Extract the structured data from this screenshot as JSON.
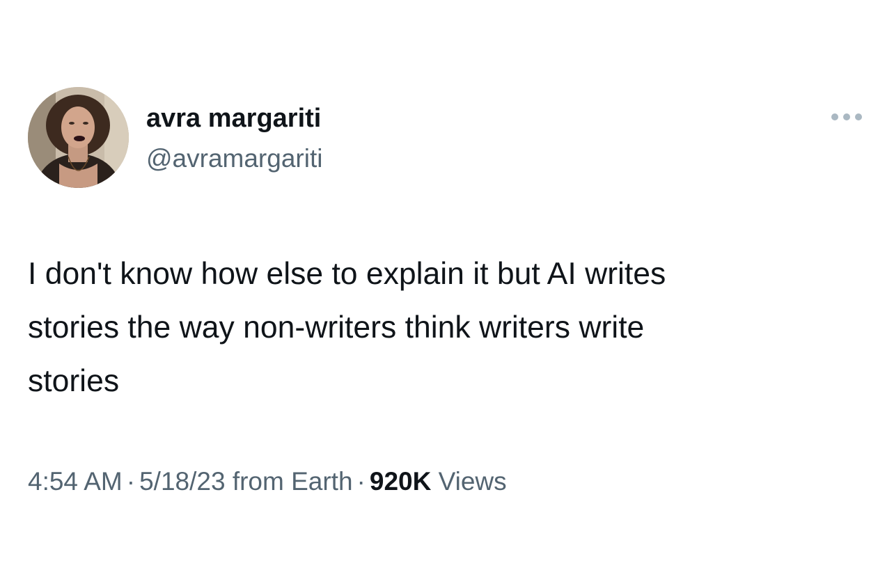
{
  "tweet": {
    "author": {
      "display_name": "avra margariti",
      "handle": "@avramargariti",
      "avatar_icon": "profile-photo"
    },
    "more_icon": "more-options-icon",
    "text": "I don't know how else to explain it but AI writes\nstories the way non-writers think writers write\nstories",
    "meta": {
      "time": "4:54 AM",
      "separator": "·",
      "date": "5/18/23",
      "source": "from Earth",
      "views_count": "920K",
      "views_label": "Views"
    }
  },
  "colors": {
    "primary_text": "#0f1419",
    "secondary_text": "#536471",
    "background": "#ffffff"
  }
}
